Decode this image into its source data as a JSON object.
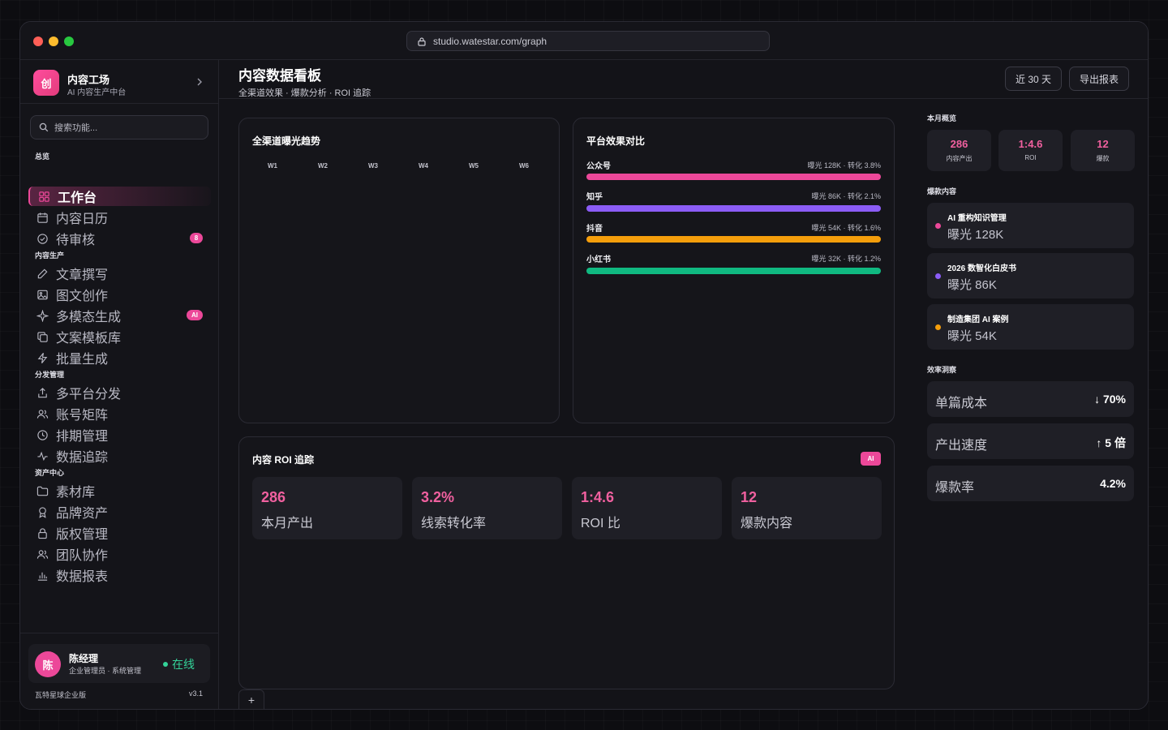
{
  "browser": {
    "url": "studio.watestar.com/graph"
  },
  "brand": {
    "logo_text": "创",
    "title": "内容工场",
    "subtitle": "AI 内容生产中台"
  },
  "search": {
    "placeholder": "搜索功能..."
  },
  "nav": {
    "sections": [
      {
        "label": "总览",
        "items": [
          {
            "label": "工作台",
            "icon": "grid-icon",
            "active": true
          },
          {
            "label": "内容日历",
            "icon": "calendar-icon"
          },
          {
            "label": "待审核",
            "icon": "check-circle-icon",
            "badge": "8"
          }
        ]
      },
      {
        "label": "内容生产",
        "items": [
          {
            "label": "文章撰写",
            "icon": "pen-icon"
          },
          {
            "label": "图文创作",
            "icon": "image-icon"
          },
          {
            "label": "多模态生成",
            "icon": "sparkle-icon",
            "badge": "AI"
          },
          {
            "label": "文案模板库",
            "icon": "copy-icon"
          },
          {
            "label": "批量生成",
            "icon": "lightning-icon"
          }
        ]
      },
      {
        "label": "分发管理",
        "items": [
          {
            "label": "多平台分发",
            "icon": "share-icon"
          },
          {
            "label": "账号矩阵",
            "icon": "users-icon"
          },
          {
            "label": "排期管理",
            "icon": "clock-icon"
          },
          {
            "label": "数据追踪",
            "icon": "activity-icon"
          }
        ]
      },
      {
        "label": "资产中心",
        "items": [
          {
            "label": "素材库",
            "icon": "folder-icon"
          },
          {
            "label": "品牌资产",
            "icon": "award-icon"
          },
          {
            "label": "版权管理",
            "icon": "lock-icon"
          },
          {
            "label": "团队协作",
            "icon": "team-icon"
          },
          {
            "label": "数据报表",
            "icon": "bar-chart-icon"
          }
        ]
      }
    ]
  },
  "user": {
    "avatar": "陈",
    "name": "陈经理",
    "role": "企业管理员 · 系统管理",
    "status": "在线"
  },
  "footer": {
    "edition": "瓦特星球企业版",
    "version": "v3.1"
  },
  "header": {
    "title": "内容数据看板",
    "subtitle": "全渠道效果 · 爆款分析 · ROI 追踪",
    "range_button": "近 30 天",
    "export_button": "导出报表"
  },
  "trend_card": {
    "title": "全渠道曝光趋势",
    "weeks": [
      "W1",
      "W2",
      "W3",
      "W4",
      "W5",
      "W6"
    ]
  },
  "platform_card": {
    "title": "平台效果对比",
    "platforms": [
      {
        "name": "公众号",
        "stat": "曝光 128K · 转化 3.8%",
        "color": "#ec4899"
      },
      {
        "name": "知乎",
        "stat": "曝光 86K · 转化 2.1%",
        "color": "#8b5cf6"
      },
      {
        "name": "抖音",
        "stat": "曝光 54K · 转化 1.6%",
        "color": "#f59e0b"
      },
      {
        "name": "小红书",
        "stat": "曝光 32K · 转化 1.2%",
        "color": "#10b981"
      }
    ]
  },
  "roi_card": {
    "title": "内容 ROI 追踪",
    "chip": "AI",
    "tiles": [
      {
        "value": "286",
        "label": "本月产出"
      },
      {
        "value": "3.2%",
        "label": "线索转化率"
      },
      {
        "value": "1:4.6",
        "label": "ROI 比"
      },
      {
        "value": "12",
        "label": "爆款内容"
      }
    ]
  },
  "add_tab": "+",
  "right_panel": {
    "overview_label": "本月概览",
    "overview": [
      {
        "value": "286",
        "label": "内容产出"
      },
      {
        "value": "1:4.6",
        "label": "ROI"
      },
      {
        "value": "12",
        "label": "爆款"
      }
    ],
    "hot_label": "爆款内容",
    "hot": [
      {
        "title": "AI 重构知识管理",
        "meta": "曝光 128K",
        "color": "#ec4899"
      },
      {
        "title": "2026 数智化白皮书",
        "meta": "曝光 86K",
        "color": "#8b5cf6"
      },
      {
        "title": "制造集团 AI 案例",
        "meta": "曝光 54K",
        "color": "#f59e0b"
      }
    ],
    "efficiency_label": "效率洞察",
    "efficiency": [
      {
        "label": "单篇成本",
        "value": "↓ 70%"
      },
      {
        "label": "产出速度",
        "value": "↑ 5 倍"
      },
      {
        "label": "爆款率",
        "value": "4.2%"
      }
    ]
  },
  "colors": {
    "accent": "#ec4899",
    "online": "#34d399"
  }
}
